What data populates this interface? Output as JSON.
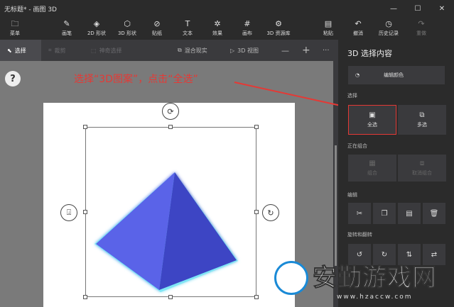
{
  "titlebar": {
    "title": "无标题* - 画图 3D",
    "min": "—",
    "max": "☐",
    "close": "✕"
  },
  "toolbar": {
    "menu": {
      "icon": "folder-icon",
      "label": "菜单"
    },
    "items": [
      {
        "icon": "brush-icon",
        "glyph": "✎",
        "label": "画笔"
      },
      {
        "icon": "2d-shapes-icon",
        "glyph": "◈",
        "label": "2D 形状"
      },
      {
        "icon": "3d-shapes-icon",
        "glyph": "⬡",
        "label": "3D 形状"
      },
      {
        "icon": "sticker-icon",
        "glyph": "⊘",
        "label": "贴纸"
      },
      {
        "icon": "text-icon",
        "glyph": "T",
        "label": "文本"
      },
      {
        "icon": "effects-icon",
        "glyph": "✲",
        "label": "效果"
      },
      {
        "icon": "canvas-icon",
        "glyph": "#",
        "label": "画布"
      },
      {
        "icon": "3d-library-icon",
        "glyph": "⚙",
        "label": "3D 资源库"
      }
    ],
    "paste": {
      "icon": "paste-icon",
      "glyph": "📋",
      "label": "粘贴"
    },
    "undo": {
      "icon": "undo-icon",
      "glyph": "↶",
      "label": "撤消"
    },
    "history": {
      "icon": "history-icon",
      "glyph": "◷",
      "label": "历史记录"
    },
    "more": {
      "icon": "redo-icon",
      "glyph": "↷",
      "label": "重做"
    }
  },
  "subbar": {
    "select": "选择",
    "crop": "裁剪",
    "magic_select": "神奇选择",
    "mixed_reality": "混合现实",
    "view_3d": "3D 视图",
    "zoom_out": "—",
    "zoom_in": "+",
    "more": "···"
  },
  "annotation": "选择“3D图案”，点击“全选”",
  "panel": {
    "title": "3D 选择内容",
    "edit_color": "编辑颜色",
    "select_section": "选择",
    "select_all": "全选",
    "multi_select": "多选",
    "grouping_section": "正在组合",
    "group": "组合",
    "ungroup": "取消组合",
    "edit_section": "编辑",
    "rotate_section": "旋转和翻转"
  },
  "watermark": {
    "brand": "安勤游戏网",
    "url": "www.hzaccw.com"
  },
  "colors": {
    "accent_red": "#e53935",
    "pyramid_left": "#5a63e8",
    "pyramid_right": "#3c44c4",
    "glow": "#7fe6f5"
  }
}
